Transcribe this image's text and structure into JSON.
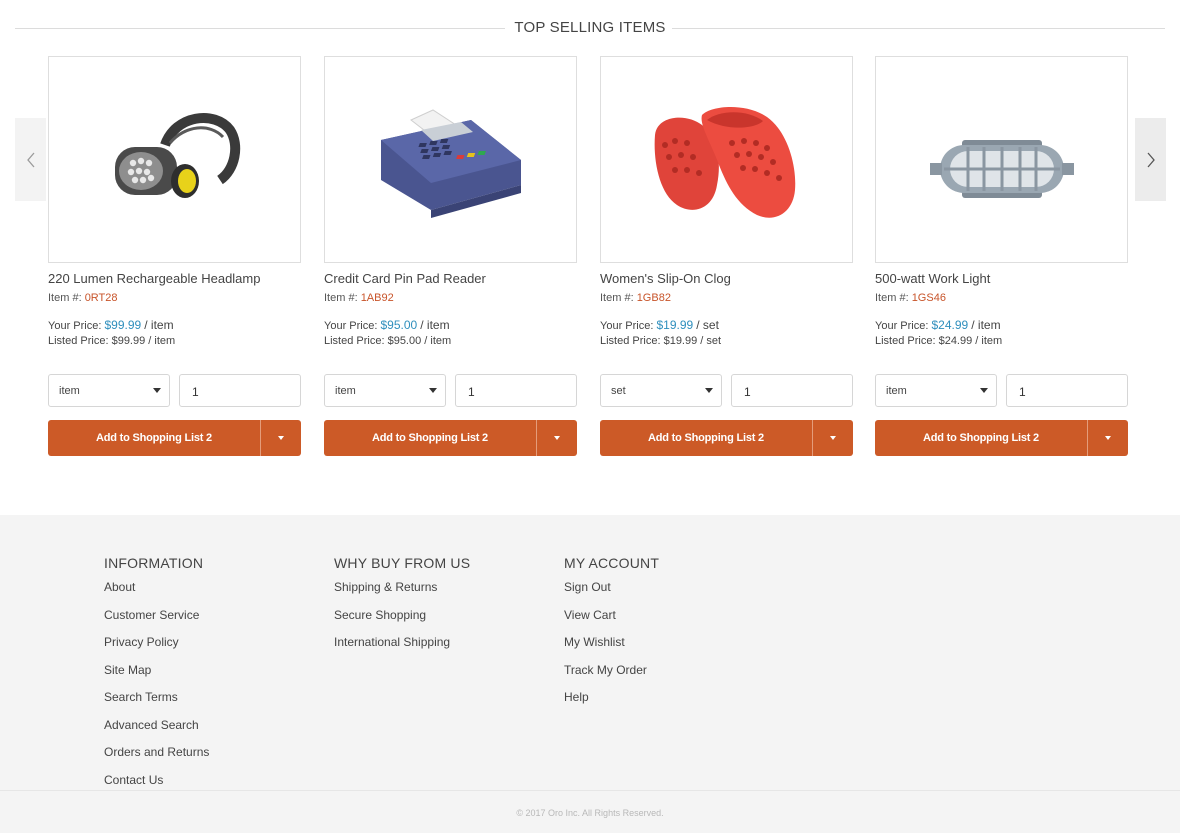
{
  "section": {
    "title": "TOP SELLING ITEMS"
  },
  "carousel": {
    "prev_icon": "chevron-left-icon",
    "next_icon": "chevron-right-icon"
  },
  "products": [
    {
      "name": "220 Lumen Rechargeable Headlamp",
      "sku_label": "Item #:",
      "sku": "0RT28",
      "your_price_label": "Your Price:",
      "your_price": "$99.99",
      "your_price_unit": "/ item",
      "listed_price": "Listed Price: $99.99 / item",
      "unit": "item",
      "quantity": "1",
      "add_label": "Add to Shopping List 2",
      "image_icon": "headlamp-image"
    },
    {
      "name": "Credit Card Pin Pad Reader",
      "sku_label": "Item #:",
      "sku": "1AB92",
      "your_price_label": "Your Price:",
      "your_price": "$95.00",
      "your_price_unit": "/ item",
      "listed_price": "Listed Price: $95.00 / item",
      "unit": "item",
      "quantity": "1",
      "add_label": "Add to Shopping List 2",
      "image_icon": "card-reader-image"
    },
    {
      "name": "Women's Slip-On Clog",
      "sku_label": "Item #:",
      "sku": "1GB82",
      "your_price_label": "Your Price:",
      "your_price": "$19.99",
      "your_price_unit": "/ set",
      "listed_price": "Listed Price: $19.99 / set",
      "unit": "set",
      "quantity": "1",
      "add_label": "Add to Shopping List 2",
      "image_icon": "clog-image"
    },
    {
      "name": "500-watt Work Light",
      "sku_label": "Item #:",
      "sku": "1GS46",
      "your_price_label": "Your Price:",
      "your_price": "$24.99",
      "your_price_unit": "/ item",
      "listed_price": "Listed Price: $24.99 / item",
      "unit": "item",
      "quantity": "1",
      "add_label": "Add to Shopping List 2",
      "image_icon": "work-light-image"
    }
  ],
  "footer": {
    "columns": [
      {
        "title": "INFORMATION",
        "links": [
          "About",
          "Customer Service",
          "Privacy Policy",
          "Site Map",
          "Search Terms",
          "Advanced Search",
          "Orders and Returns",
          "Contact Us"
        ]
      },
      {
        "title": "WHY BUY FROM US",
        "links": [
          "Shipping & Returns",
          "Secure Shopping",
          "International Shipping"
        ]
      },
      {
        "title": "MY ACCOUNT",
        "links": [
          "Sign Out",
          "View Cart",
          "My Wishlist",
          "Track My Order",
          "Help"
        ]
      }
    ],
    "copyright": "© 2017 Oro Inc. All Rights Reserved."
  },
  "colors": {
    "accent": "#cc5a27",
    "price": "#2f8fbd",
    "sku": "#c8542a"
  }
}
